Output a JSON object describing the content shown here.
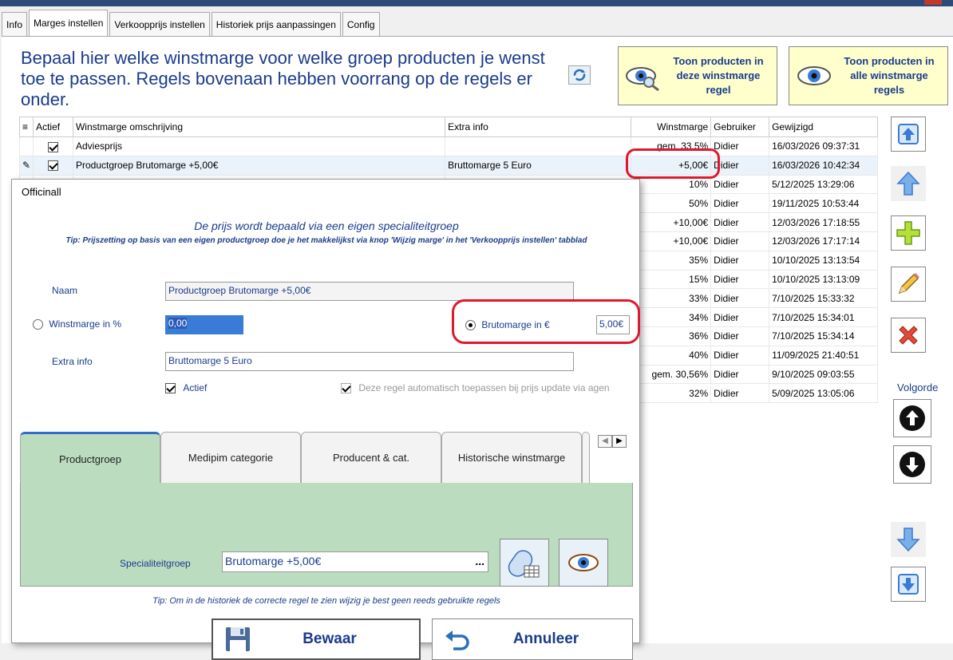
{
  "tabs": [
    "Info",
    "Marges instellen",
    "Verkoopprijs instellen",
    "Historiek prijs aanpassingen",
    "Config"
  ],
  "heading": "Bepaal hier welke winstmarge voor welke groep producten je wenst toe te passen. Regels bovenaan hebben voorrang op de regels er onder.",
  "btn_show_rule": "Toon producten in deze winstmarge regel",
  "btn_show_all": "Toon producten in alle winstmarge regels",
  "columns": {
    "actief": "Actief",
    "omschrijving": "Winstmarge omschrijving",
    "extra": "Extra info",
    "marge": "Winstmarge",
    "gebruiker": "Gebruiker",
    "gewijzigd": "Gewijzigd"
  },
  "rows": [
    {
      "actief": true,
      "omschrijving": "Adviesprijs",
      "extra": "",
      "marge": "gem. 33,5%",
      "gebruiker": "Didier",
      "gewijzigd": "16/03/2026 09:37:31"
    },
    {
      "actief": true,
      "omschrijving": "Productgroep Brutomarge +5,00€",
      "extra": "Bruttomarge 5 Euro",
      "marge": "+5,00€",
      "gebruiker": "Didier",
      "gewijzigd": "16/03/2026 10:42:34"
    },
    {
      "marge": "10%",
      "gebruiker": "Didier",
      "gewijzigd": "5/12/2025 13:29:06"
    },
    {
      "marge": "50%",
      "gebruiker": "Didier",
      "gewijzigd": "19/11/2025 10:53:44"
    },
    {
      "marge": "+10,00€",
      "gebruiker": "Didier",
      "gewijzigd": "12/03/2026 17:18:55"
    },
    {
      "marge": "+10,00€",
      "gebruiker": "Didier",
      "gewijzigd": "12/03/2026 17:17:14"
    },
    {
      "marge": "35%",
      "gebruiker": "Didier",
      "gewijzigd": "10/10/2025 13:13:54"
    },
    {
      "marge": "15%",
      "gebruiker": "Didier",
      "gewijzigd": "10/10/2025 13:13:09"
    },
    {
      "marge": "33%",
      "gebruiker": "Didier",
      "gewijzigd": "7/10/2025 15:33:32"
    },
    {
      "marge": "34%",
      "gebruiker": "Didier",
      "gewijzigd": "7/10/2025 15:34:01"
    },
    {
      "marge": "36%",
      "gebruiker": "Didier",
      "gewijzigd": "7/10/2025 15:34:14"
    },
    {
      "marge": "40%",
      "gebruiker": "Didier",
      "gewijzigd": "11/09/2025 21:40:51"
    },
    {
      "marge": "gem. 30,56%",
      "gebruiker": "Didier",
      "gewijzigd": "9/10/2025 09:03:55"
    },
    {
      "marge": "32%",
      "gebruiker": "Didier",
      "gewijzigd": "5/09/2025 13:05:06"
    }
  ],
  "volgorde": "Volgorde",
  "dialog": {
    "title": "Officinall",
    "headline": "De prijs wordt bepaald via een eigen specialiteitgroep",
    "tip_top": "Tip: Prijszetting op basis van een eigen productgroep doe je het makkelijkst via knop 'Wijzig marge' in het 'Verkoopprijs instellen' tabblad",
    "naam_label": "Naam",
    "naam_value": "Productgroep Brutomarge +5,00€",
    "winstmarge_label": "Winstmarge in %",
    "winstmarge_value": "0,00",
    "brutomarge_label": "Brutomarge in €",
    "brutomarge_value": "5,00€",
    "extra_label": "Extra info",
    "extra_value": "Bruttomarge 5 Euro",
    "actief_label": "Actief",
    "auto_label": "Deze regel automatisch toepassen bij prijs update via agen",
    "subtabs": [
      "Productgroep",
      "Medipim categorie",
      "Producent & cat.",
      "Historische winstmarge"
    ],
    "spec_label": "Specialiteitgroep",
    "spec_value": "Brutomarge +5,00€",
    "spec_ellipsis": "...",
    "tip_bottom": "Tip: Om in de historiek de correcte regel te zien wijzig je best geen reeds gebruikte regels",
    "save": "Bewaar",
    "cancel": "Annuleer"
  }
}
